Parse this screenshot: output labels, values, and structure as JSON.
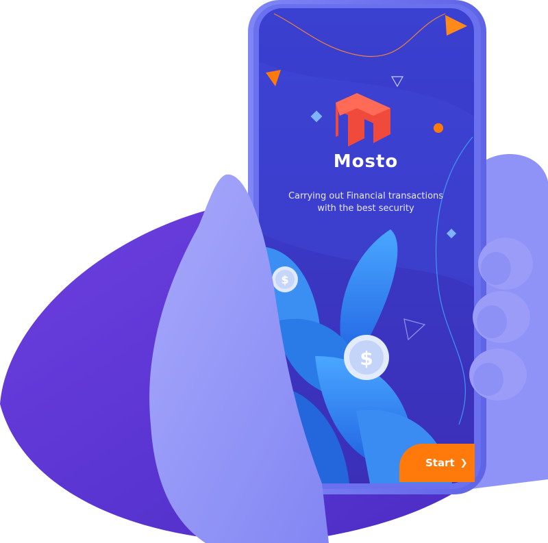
{
  "app": {
    "name": "Mosto",
    "tagline_line1": "Carrying out Financial transactions",
    "tagline_line2": "with the best security"
  },
  "start_button": {
    "label": "Start",
    "icon": "chevron-right-icon",
    "color": "#ff7a0a"
  },
  "colors": {
    "screen_bg": "#3c3fd0",
    "hand": "#8a8cf5",
    "sleeve": "#5a33d6",
    "leaf": "#2f86f2",
    "logo": "#ef4a3c",
    "accent": "#ff7a0a"
  }
}
